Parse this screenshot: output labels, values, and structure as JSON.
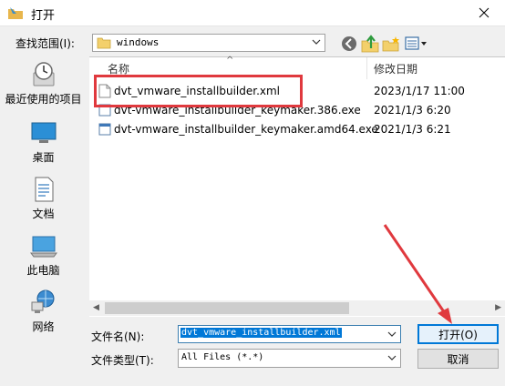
{
  "window": {
    "title": "打开"
  },
  "lookin": {
    "label": "查找范围(I):",
    "value": "windows"
  },
  "places": [
    {
      "label": "最近使用的项目",
      "icon": "recent-items-icon"
    },
    {
      "label": "桌面",
      "icon": "desktop-icon"
    },
    {
      "label": "文档",
      "icon": "documents-icon"
    },
    {
      "label": "此电脑",
      "icon": "this-pc-icon"
    },
    {
      "label": "网络",
      "icon": "network-icon"
    }
  ],
  "columns": {
    "name": "名称",
    "modified": "修改日期"
  },
  "files": [
    {
      "name": "dvt_vmware_installbuilder.xml",
      "modified": "2023/1/17 11:00",
      "icon": "xml-file-icon"
    },
    {
      "name": "dvt-vmware_installbuilder_keymaker.386.exe",
      "modified": "2021/1/3 6:20",
      "icon": "exe-file-icon"
    },
    {
      "name": "dvt-vmware_installbuilder_keymaker.amd64.exe",
      "modified": "2021/1/3 6:21",
      "icon": "exe-file-icon"
    }
  ],
  "filename": {
    "label": "文件名(N):",
    "value": "dvt_vmware_installbuilder.xml"
  },
  "filetype": {
    "label": "文件类型(T):",
    "value": "All Files (*.*)"
  },
  "buttons": {
    "open": "打开(O)",
    "cancel": "取消"
  },
  "colors": {
    "accent": "#0078d7",
    "annotation": "#e0393e"
  }
}
